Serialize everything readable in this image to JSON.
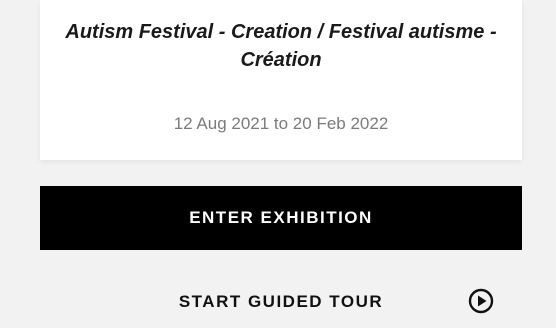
{
  "exhibition": {
    "title": "Autism Festival - Creation / Festival autisme - Création",
    "dates": "12 Aug 2021 to 20 Feb 2022"
  },
  "actions": {
    "enter_label": "ENTER EXHIBITION",
    "tour_label": "START GUIDED TOUR",
    "tour_icon": "play-circle-icon"
  },
  "colors": {
    "primary_button_bg": "#000000",
    "primary_button_text": "#ffffff",
    "date_text": "#7b7b7b"
  }
}
